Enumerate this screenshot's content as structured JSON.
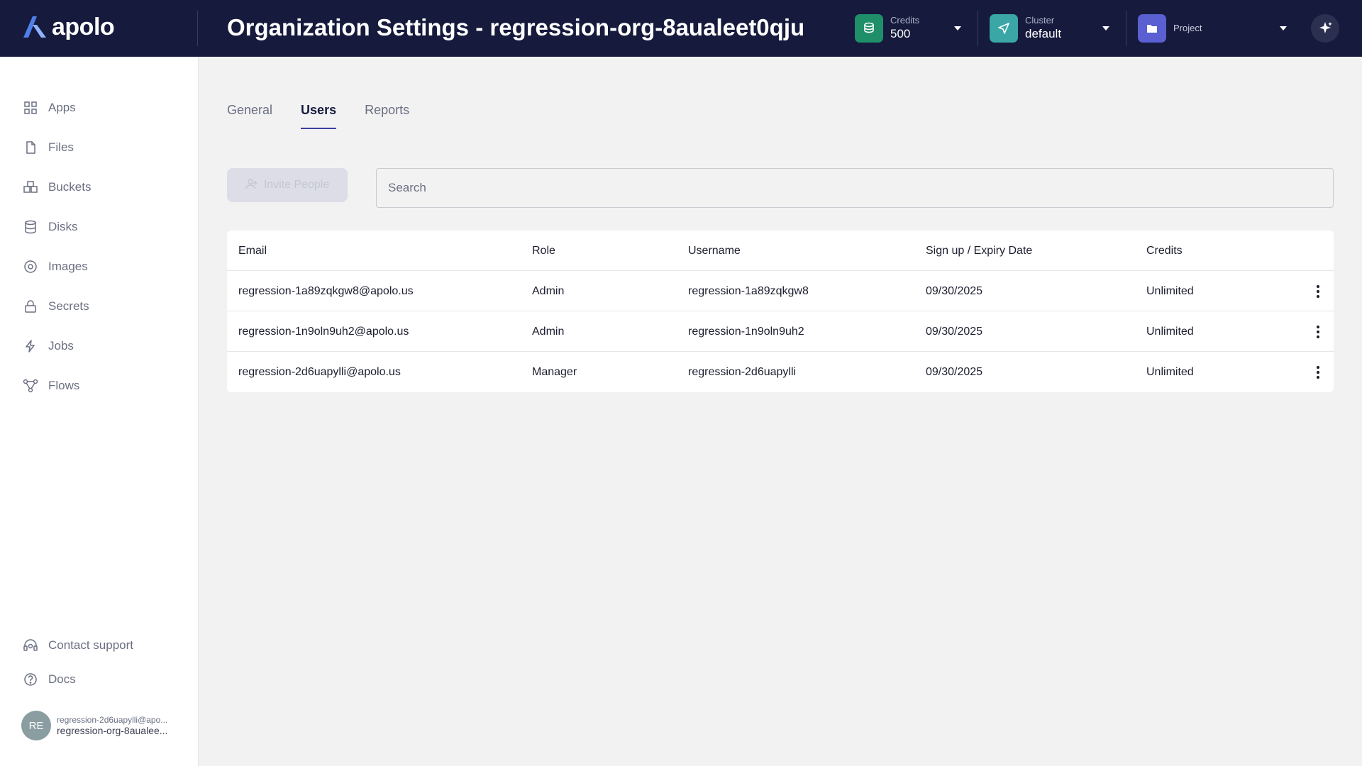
{
  "header": {
    "logo_text": "apolo",
    "title": "Organization Settings - regression-org-8aualeet0qju",
    "credits": {
      "label": "Credits",
      "value": "500",
      "icon": "coins-icon",
      "color": "#1f8f6a"
    },
    "cluster": {
      "label": "Cluster",
      "value": "default",
      "icon": "send-icon",
      "color": "#3aa6a6"
    },
    "project": {
      "label": "Project",
      "icon": "folder-icon",
      "color": "#5a5fd1"
    },
    "ai_icon": "sparkle-icon"
  },
  "sidebar": {
    "items": [
      {
        "label": "Apps",
        "icon": "apps-icon"
      },
      {
        "label": "Files",
        "icon": "file-icon"
      },
      {
        "label": "Buckets",
        "icon": "bucket-icon"
      },
      {
        "label": "Disks",
        "icon": "disk-icon"
      },
      {
        "label": "Images",
        "icon": "image-icon"
      },
      {
        "label": "Secrets",
        "icon": "lock-icon"
      },
      {
        "label": "Jobs",
        "icon": "bolt-icon"
      },
      {
        "label": "Flows",
        "icon": "flow-icon"
      }
    ],
    "footer": [
      {
        "label": "Contact support",
        "icon": "headset-icon"
      },
      {
        "label": "Docs",
        "icon": "help-icon"
      }
    ],
    "user": {
      "initials": "RE",
      "email": "regression-2d6uapylli@apo...",
      "org": "regression-org-8aualee..."
    }
  },
  "tabs": [
    {
      "label": "General",
      "active": false
    },
    {
      "label": "Users",
      "active": true
    },
    {
      "label": "Reports",
      "active": false
    }
  ],
  "invite_button": {
    "label": "Invite People",
    "icon": "add-user-icon"
  },
  "search": {
    "placeholder": "Search",
    "value": ""
  },
  "table": {
    "columns": [
      "Email",
      "Role",
      "Username",
      "Sign up / Expiry Date",
      "Credits"
    ],
    "rows": [
      {
        "email": "regression-1a89zqkgw8@apolo.us",
        "role": "Admin",
        "username": "regression-1a89zqkgw8",
        "date": "09/30/2025",
        "credits": "Unlimited"
      },
      {
        "email": "regression-1n9oln9uh2@apolo.us",
        "role": "Admin",
        "username": "regression-1n9oln9uh2",
        "date": "09/30/2025",
        "credits": "Unlimited"
      },
      {
        "email": "regression-2d6uapylli@apolo.us",
        "role": "Manager",
        "username": "regression-2d6uapylli",
        "date": "09/30/2025",
        "credits": "Unlimited"
      }
    ]
  }
}
